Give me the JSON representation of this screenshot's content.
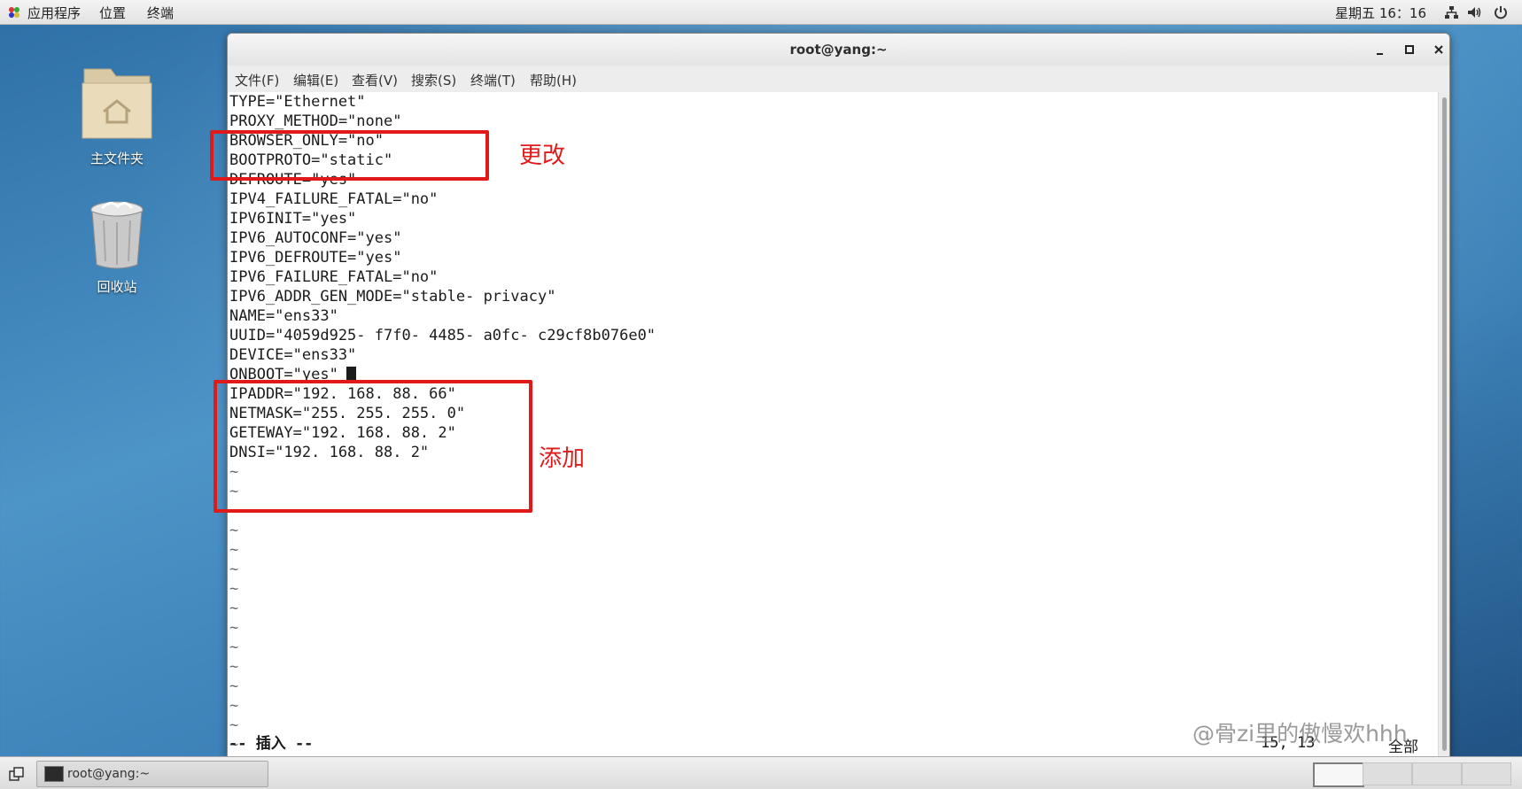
{
  "top_panel": {
    "applications": "应用程序",
    "places": "位置",
    "terminal": "终端",
    "clock": "星期五 16：16",
    "icons": [
      "network-icon",
      "volume-icon",
      "power-icon"
    ]
  },
  "desktop": {
    "home_folder": "主文件夹",
    "trash": "回收站"
  },
  "window": {
    "title": "root@yang:~",
    "menu": [
      "文件(F)",
      "编辑(E)",
      "查看(V)",
      "搜索(S)",
      "终端(T)",
      "帮助(H)"
    ],
    "lines": [
      "TYPE=\"Ethernet\"",
      "PROXY_METHOD=\"none\"",
      "BROWSER_ONLY=\"no\"",
      "BOOTPROTO=\"static\"",
      "DEFROUTE=\"yes\"",
      "IPV4_FAILURE_FATAL=\"no\"",
      "IPV6INIT=\"yes\"",
      "IPV6_AUTOCONF=\"yes\"",
      "IPV6_DEFROUTE=\"yes\"",
      "IPV6_FAILURE_FATAL=\"no\"",
      "IPV6_ADDR_GEN_MODE=\"stable- privacy\"",
      "NAME=\"ens33\"",
      "UUID=\"4059d925- f7f0- 4485- a0fc- c29cf8b076e0\"",
      "DEVICE=\"ens33\"",
      "ONBOOT=\"yes\"",
      "IPADDR=\"192. 168. 88. 66\"",
      "NETMASK=\"255. 255. 255. 0\"",
      "GETEWAY=\"192. 168. 88. 2\"",
      "DNSI=\"192. 168. 88. 2\""
    ],
    "tilde": "~",
    "mode": "-- 插入 --",
    "position": "15, 13",
    "scope": "全部"
  },
  "annotations": {
    "changed": "更改",
    "added": "添加",
    "color": "#e01a1a"
  },
  "watermark": "@骨zi里的傲慢欢hhh",
  "taskbar": {
    "task_label": "root@yang:~"
  }
}
